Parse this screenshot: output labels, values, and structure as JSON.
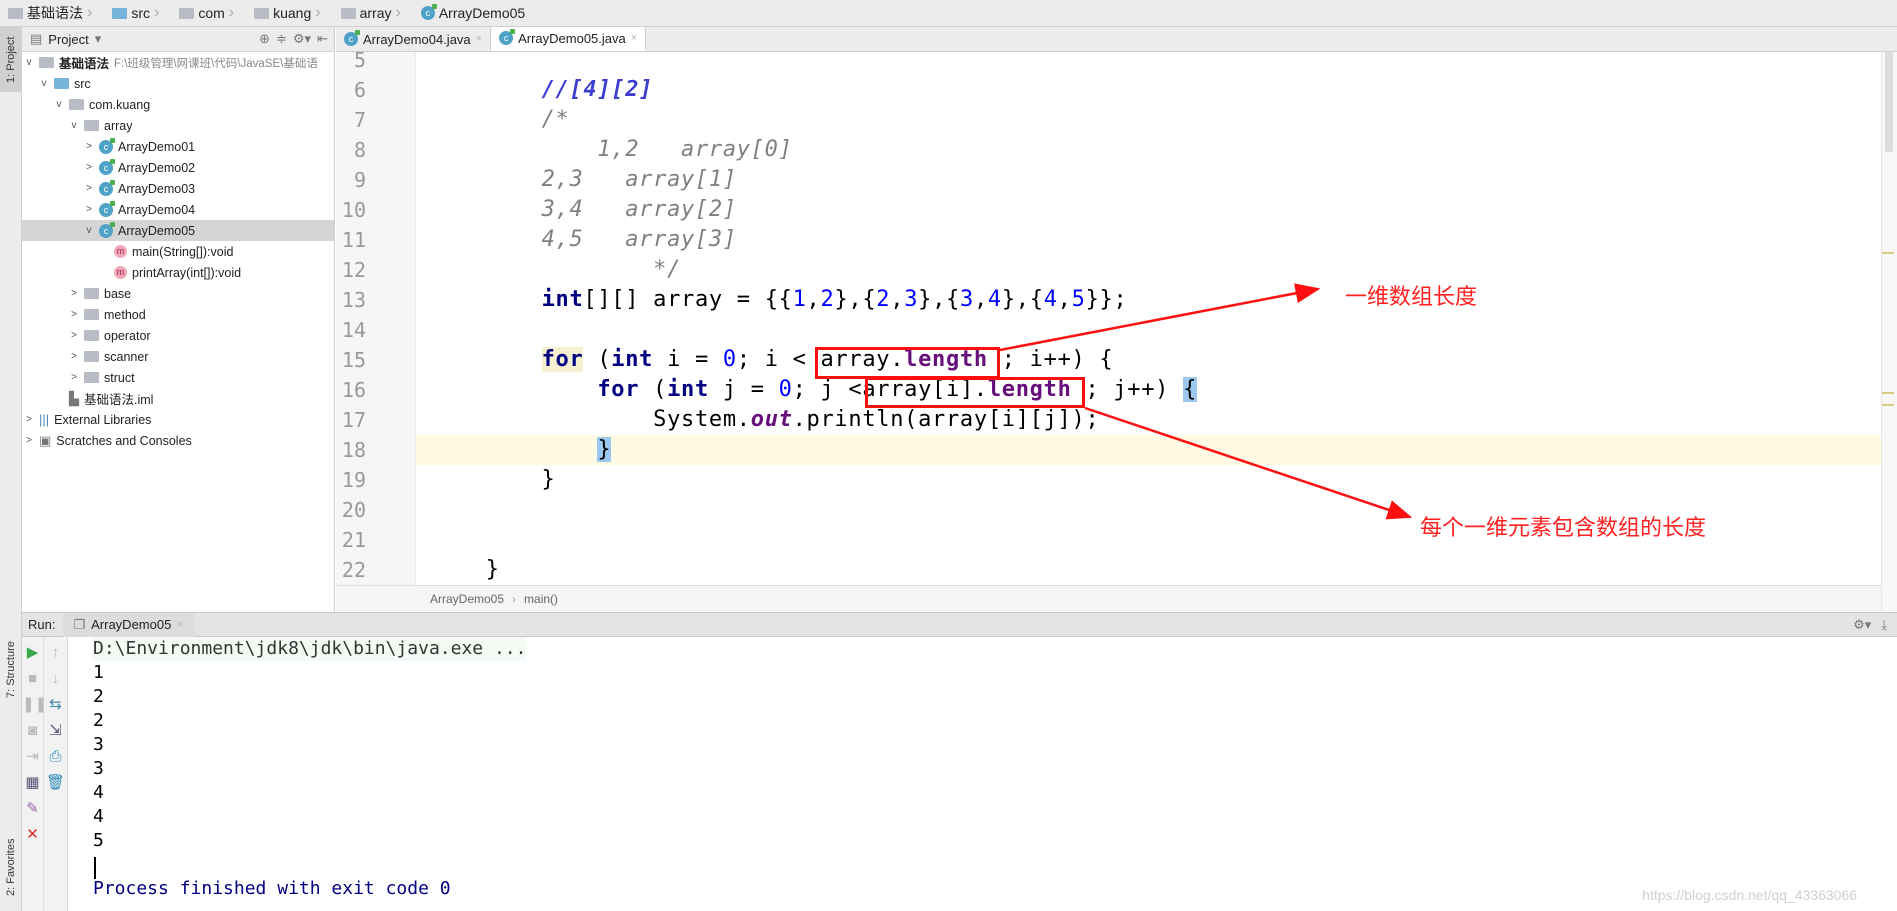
{
  "breadcrumb": [
    "基础语法",
    "src",
    "com",
    "kuang",
    "array",
    "ArrayDemo05"
  ],
  "left_strip": {
    "project": "1: Project",
    "structure": "7: Structure",
    "favorites": "2: Favorites"
  },
  "project_panel": {
    "title": "Project",
    "root": {
      "name": "基础语法",
      "path": "F:\\班级管理\\网课班\\代码\\JavaSE\\基础语"
    },
    "items": [
      {
        "label": "src",
        "icon": "folder-blue",
        "arrow": "v",
        "level": 1
      },
      {
        "label": "com.kuang",
        "icon": "folder",
        "arrow": "v",
        "level": 2
      },
      {
        "label": "array",
        "icon": "folder",
        "arrow": "v",
        "level": 3
      },
      {
        "label": "ArrayDemo01",
        "icon": "class",
        "arrow": ">",
        "level": 4
      },
      {
        "label": "ArrayDemo02",
        "icon": "class",
        "arrow": ">",
        "level": 4
      },
      {
        "label": "ArrayDemo03",
        "icon": "class",
        "arrow": ">",
        "level": 4
      },
      {
        "label": "ArrayDemo04",
        "icon": "class",
        "arrow": ">",
        "level": 4
      },
      {
        "label": "ArrayDemo05",
        "icon": "class",
        "arrow": "v",
        "level": 4,
        "selected": true
      },
      {
        "label": "main(String[]):void",
        "icon": "method",
        "arrow": "",
        "level": 5
      },
      {
        "label": "printArray(int[]):void",
        "icon": "method",
        "arrow": "",
        "level": 5
      },
      {
        "label": "base",
        "icon": "folder",
        "arrow": ">",
        "level": 3
      },
      {
        "label": "method",
        "icon": "folder",
        "arrow": ">",
        "level": 3
      },
      {
        "label": "operator",
        "icon": "folder",
        "arrow": ">",
        "level": 3
      },
      {
        "label": "scanner",
        "icon": "folder",
        "arrow": ">",
        "level": 3
      },
      {
        "label": "struct",
        "icon": "folder",
        "arrow": ">",
        "level": 3
      },
      {
        "label": "基础语法.iml",
        "icon": "iml",
        "arrow": "",
        "level": 2
      },
      {
        "label": "External Libraries",
        "icon": "libraries",
        "arrow": ">",
        "level": 0
      },
      {
        "label": "Scratches and Consoles",
        "icon": "scratches",
        "arrow": ">",
        "level": 0
      }
    ]
  },
  "editor_tabs": [
    {
      "label": "ArrayDemo04.java",
      "active": false
    },
    {
      "label": "ArrayDemo05.java",
      "active": true
    }
  ],
  "editor": {
    "current_line": 18,
    "lines": [
      {
        "n": "5",
        "tokens": []
      },
      {
        "n": "6",
        "tokens": [
          {
            "t": "        "
          },
          {
            "t": "//[4][2]",
            "c": "dc"
          }
        ]
      },
      {
        "n": "7",
        "tokens": [
          {
            "t": "        "
          },
          {
            "t": "/*",
            "c": "cm"
          }
        ]
      },
      {
        "n": "8",
        "tokens": [
          {
            "t": "            "
          },
          {
            "t": "1,2   array[0]",
            "c": "cm"
          }
        ]
      },
      {
        "n": "9",
        "tokens": [
          {
            "t": "        "
          },
          {
            "t": "2,3   array[1]",
            "c": "cm"
          }
        ]
      },
      {
        "n": "10",
        "tokens": [
          {
            "t": "        "
          },
          {
            "t": "3,4   array[2]",
            "c": "cm"
          }
        ]
      },
      {
        "n": "11",
        "tokens": [
          {
            "t": "        "
          },
          {
            "t": "4,5   array[3]",
            "c": "cm"
          }
        ]
      },
      {
        "n": "12",
        "tokens": [
          {
            "t": "                "
          },
          {
            "t": "*/",
            "c": "cm"
          }
        ]
      },
      {
        "n": "13",
        "tokens": [
          {
            "t": "        "
          },
          {
            "t": "int",
            "c": "kw"
          },
          {
            "t": "[][] array = {{"
          },
          {
            "t": "1",
            "c": "num"
          },
          {
            "t": ","
          },
          {
            "t": "2",
            "c": "num"
          },
          {
            "t": "},{"
          },
          {
            "t": "2",
            "c": "num"
          },
          {
            "t": ","
          },
          {
            "t": "3",
            "c": "num"
          },
          {
            "t": "},{"
          },
          {
            "t": "3",
            "c": "num"
          },
          {
            "t": ","
          },
          {
            "t": "4",
            "c": "num"
          },
          {
            "t": "},{"
          },
          {
            "t": "4",
            "c": "num"
          },
          {
            "t": ","
          },
          {
            "t": "5",
            "c": "num"
          },
          {
            "t": "}};"
          }
        ]
      },
      {
        "n": "14",
        "tokens": []
      },
      {
        "n": "15",
        "tokens": [
          {
            "t": "        "
          },
          {
            "t": "for",
            "c": "kw kwbg"
          },
          {
            "t": " ("
          },
          {
            "t": "int",
            "c": "kw"
          },
          {
            "t": " i = "
          },
          {
            "t": "0",
            "c": "num"
          },
          {
            "t": "; i < array."
          },
          {
            "t": "length",
            "c": "fld"
          },
          {
            "t": " ; i++) {"
          }
        ]
      },
      {
        "n": "16",
        "tokens": [
          {
            "t": "            "
          },
          {
            "t": "for",
            "c": "kw"
          },
          {
            "t": " ("
          },
          {
            "t": "int",
            "c": "kw"
          },
          {
            "t": " j = "
          },
          {
            "t": "0",
            "c": "num"
          },
          {
            "t": "; j <array[i]."
          },
          {
            "t": "length",
            "c": "fld"
          },
          {
            "t": " ; j++) "
          },
          {
            "t": "{",
            "c": "brbg"
          }
        ]
      },
      {
        "n": "17",
        "tokens": [
          {
            "t": "                System."
          },
          {
            "t": "out",
            "c": "sfld"
          },
          {
            "t": ".println(array[i][j]);"
          }
        ]
      },
      {
        "n": "18",
        "tokens": [
          {
            "t": "            "
          },
          {
            "t": "}",
            "c": "brbg"
          }
        ]
      },
      {
        "n": "19",
        "tokens": [
          {
            "t": "        }"
          }
        ]
      },
      {
        "n": "20",
        "tokens": []
      },
      {
        "n": "21",
        "tokens": []
      },
      {
        "n": "22",
        "tokens": [
          {
            "t": "    }"
          }
        ]
      }
    ],
    "breadcrumb": [
      "ArrayDemo05",
      "main()"
    ]
  },
  "annotations": {
    "color": "#ff1010",
    "outer_length": "一维数组长度",
    "inner_length": "每个一维元素包含数组的长度"
  },
  "run": {
    "label": "Run:",
    "tab": "ArrayDemo05",
    "output": [
      "D:\\Environment\\jdk8\\jdk\\bin\\java.exe ...",
      "1",
      "2",
      "2",
      "3",
      "3",
      "4",
      "4",
      "5",
      "",
      "Process finished with exit code 0"
    ]
  },
  "watermark": "https://blog.csdn.net/qq_43363066"
}
